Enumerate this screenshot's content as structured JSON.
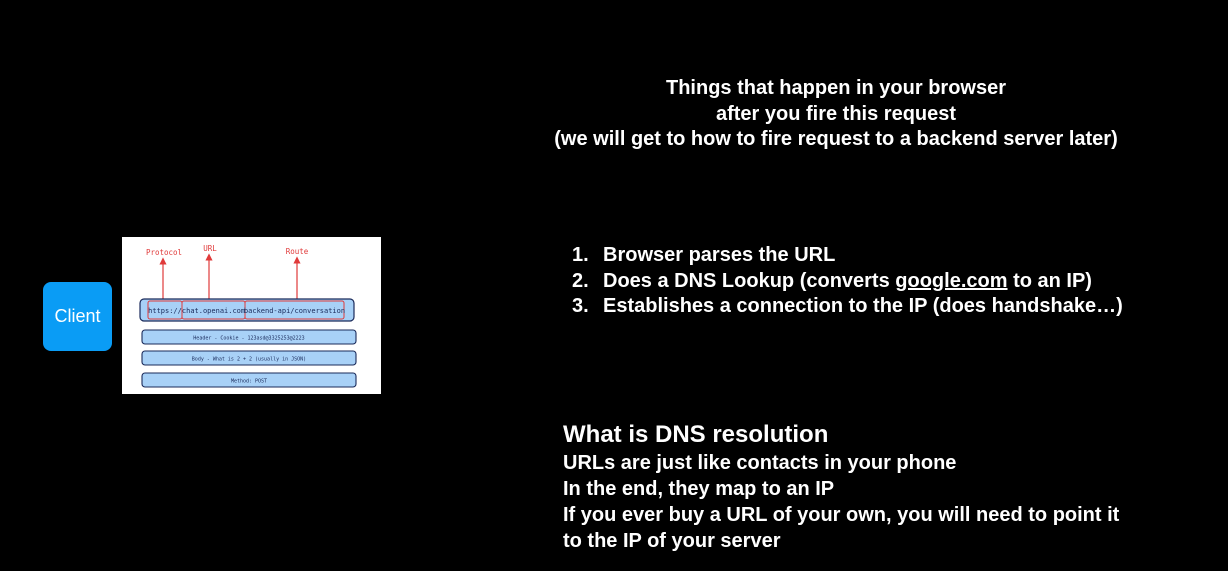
{
  "heading": {
    "line1": "Things that happen in your browser",
    "line2": "after you fire this request",
    "line3": "(we will get to how to fire request to a backend server later)"
  },
  "client": {
    "label": "Client"
  },
  "request_diagram": {
    "labels": {
      "protocol": "Protocol",
      "url": "URL",
      "route": "Route"
    },
    "url_segments": {
      "protocol": "https://",
      "host": "chat.openai.com",
      "path": "backend-api/conversation"
    },
    "rows": {
      "header": "Header - Cookie - 123asd@3325253@2223",
      "body": "Body - What is 2 + 2 (usually in JSON)",
      "method": "Method: POST"
    },
    "colors": {
      "row_fill": "#a8d1f7",
      "row_stroke": "#1a2a5a",
      "annotation": "#e03a3a"
    }
  },
  "steps": [
    {
      "num": "1.",
      "text": "Browser parses the URL"
    },
    {
      "num": "2.",
      "before": "Does a DNS Lookup (converts ",
      "link": "google.com",
      "after": " to an IP)"
    },
    {
      "num": "3.",
      "text": "Establishes a connection to the IP (does handshake…)"
    }
  ],
  "dns": {
    "title": "What is DNS resolution",
    "lines": [
      "URLs are just like contacts in your phone",
      "In the end, they map to an IP",
      "If you ever buy a URL of your own, you will need to point it",
      "to the IP of your server"
    ]
  },
  "colors": {
    "background": "#000000",
    "text": "#ffffff",
    "client_fill": "#0a9cf5"
  }
}
